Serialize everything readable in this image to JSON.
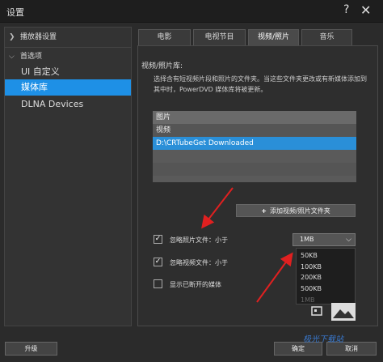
{
  "window": {
    "title": "设置",
    "help_glyph": "?",
    "close_glyph": "✕"
  },
  "sidebar": {
    "groups": [
      {
        "label": "播放器设置",
        "chevron": "❯"
      },
      {
        "label": "首选项",
        "chevron": "⌵"
      }
    ],
    "items": [
      {
        "label": "UI 自定义"
      },
      {
        "label": "媒体库"
      },
      {
        "label": "DLNA Devices"
      }
    ]
  },
  "tabs": [
    {
      "label": "电影"
    },
    {
      "label": "电视节目"
    },
    {
      "label": "视频/照片"
    },
    {
      "label": "音乐"
    }
  ],
  "main": {
    "heading": "视频/照片库:",
    "description": "选择含有短视频片段和照片的文件夹。当这些文件夹更改或有新媒体添加到其中时，PowerDVD 媒体库将被更新。",
    "folders": {
      "header": "图片",
      "rows": [
        "视频",
        "D:\\CRTubeGet Downloaded",
        "",
        "",
        ""
      ]
    },
    "add_button": {
      "plus": "+",
      "label": "添加视频/照片文件夹"
    },
    "ignore_photo": {
      "label": "忽略照片文件：小于",
      "checked": "✓"
    },
    "ignore_video": {
      "label": "忽略视频文件：小于",
      "checked": "✓"
    },
    "show_disconnected": {
      "label": "显示已断开的媒体"
    },
    "size_select": {
      "value": "1MB",
      "arrow": "⌵"
    },
    "size_options": [
      "50KB",
      "100KB",
      "200KB",
      "500KB",
      "1MB"
    ]
  },
  "footer": {
    "upgrade_label": "升级",
    "ok_label": "确定",
    "cancel_label": "取消",
    "watermark": "极光下载站"
  },
  "colors": {
    "accent": "#1e90e6",
    "selection": "#2a8fd8",
    "background": "#2b2b2b"
  }
}
